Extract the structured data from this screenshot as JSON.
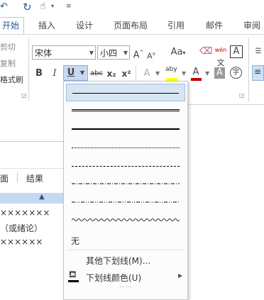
{
  "tabs": {
    "home": "开始",
    "insert": "插入",
    "design": "设计",
    "layout": "页面布局",
    "references": "引用",
    "mailings": "邮件",
    "review": "审阅"
  },
  "clipboard": {
    "cut": "剪切",
    "copy": "复制",
    "format_painter": "格式刷"
  },
  "font": {
    "name": "宋体",
    "size": "小四",
    "grow": "A",
    "shrink": "A",
    "case": "Aa",
    "phonetic": "wén",
    "bold": "B",
    "italic": "I",
    "underline": "U",
    "strike": "abc",
    "subscript": "x₂",
    "superscript": "x²",
    "effect": "A",
    "highlight": "aby",
    "color": "A",
    "shading": "A",
    "enclose": "字"
  },
  "doc": {
    "nav_page": "面",
    "nav_results": "结果",
    "line1": "×××××××",
    "line2": "（或绪论）",
    "line3": "××××××"
  },
  "menu": {
    "none_label": "无",
    "more_underlines": "其他下划线(M)...",
    "underline_color": "下划线颜色(U)",
    "more_dots": "⋯⋯"
  },
  "colors": {
    "accent": "#2b579a",
    "font_color_bar": "#c00000",
    "highlight_bar": "#ffff00",
    "menu_selected": "#d7e4f2"
  }
}
